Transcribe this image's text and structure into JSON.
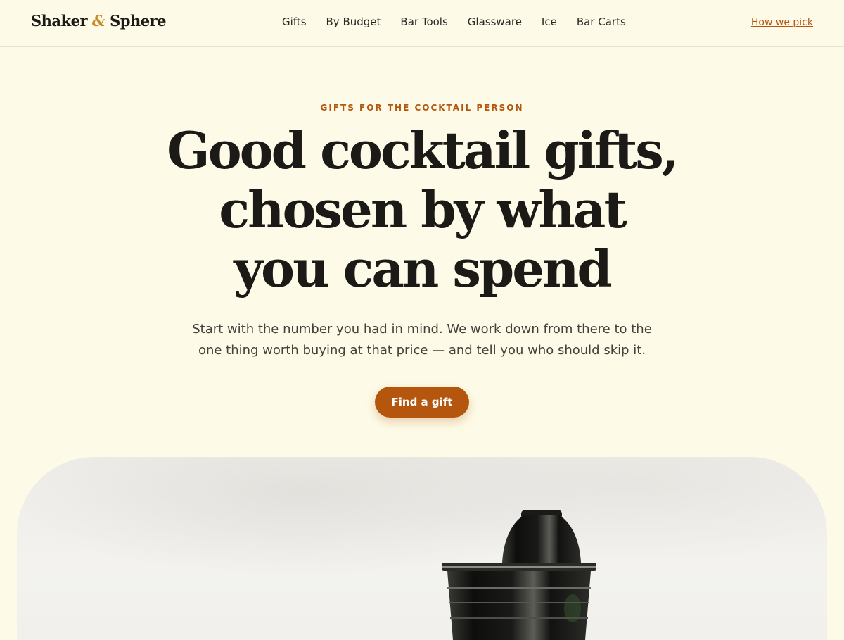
{
  "header": {
    "logo": {
      "part1": "Shaker",
      "amp": "&",
      "part2": "Sphere"
    },
    "nav": [
      "Gifts",
      "By Budget",
      "Bar Tools",
      "Glassware",
      "Ice",
      "Bar Carts"
    ],
    "how_we_pick": "How we pick"
  },
  "hero": {
    "eyebrow": "GIFTS FOR THE COCKTAIL PERSON",
    "headline": [
      "Good cocktail gifts,",
      "chosen by what",
      "you can spend"
    ],
    "subtext": [
      "Start with the number you had in mind. We work down from there to the",
      "one thing worth buying at that price — and tell you who should skip it."
    ],
    "cta_label": "Find a gift"
  },
  "colors": {
    "background": "#fdfbe7",
    "accent": "#b5560f",
    "logo_amp": "#c98a2a",
    "text": "#1c1a17"
  },
  "image": {
    "subject": "cocktail-shaker-icon"
  }
}
